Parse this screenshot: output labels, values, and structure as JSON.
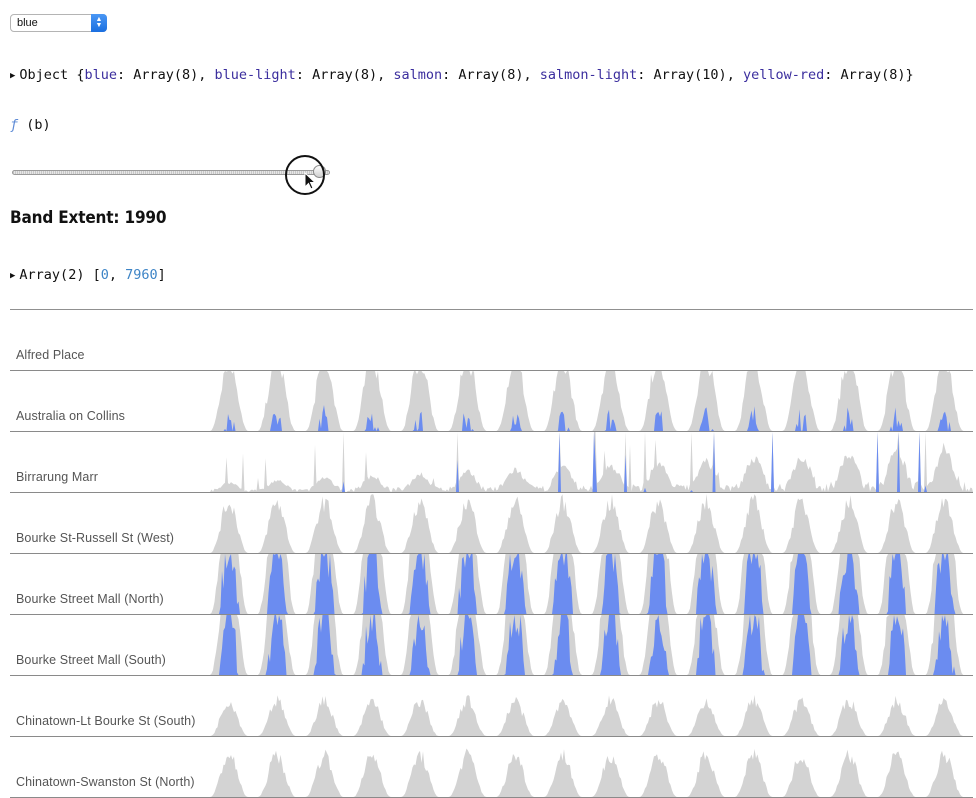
{
  "palette_select": {
    "value": "blue"
  },
  "object_line": {
    "prefix": "Object {",
    "entries": [
      {
        "key": "blue",
        "value": "Array(8)"
      },
      {
        "key": "blue-light",
        "value": "Array(8)"
      },
      {
        "key": "salmon",
        "value": "Array(8)"
      },
      {
        "key": "salmon-light",
        "value": "Array(10)"
      },
      {
        "key": "yellow-red",
        "value": "Array(8)"
      }
    ],
    "suffix": "}"
  },
  "function_line": {
    "f": "ƒ",
    "params": "(b)"
  },
  "slider": {
    "value": 1990
  },
  "band_title": "Band Extent: 1990",
  "array_line": {
    "prefix": "Array(2) [",
    "v0": "0",
    "sep": ", ",
    "v1": "7960",
    "suffix": "]"
  },
  "colors": {
    "gray_area": "#d3d3d3",
    "blue_band": "#6b8cf0",
    "text": "#111111"
  },
  "chart_data": {
    "type": "area",
    "band_extent": 1990,
    "y_extent": [
      0,
      7960
    ],
    "series": [
      {
        "name": "Alfred Place",
        "peak": 0
      },
      {
        "name": "Australia on Collins",
        "peak": 2650
      },
      {
        "name": "Birrarung Marr",
        "peak": 4000
      },
      {
        "name": "Bourke St-Russell St (West)",
        "peak": 1800
      },
      {
        "name": "Bourke Street Mall (North)",
        "peak": 4800
      },
      {
        "name": "Bourke Street Mall (South)",
        "peak": 4500
      },
      {
        "name": "Chinatown-Lt Bourke St (South)",
        "peak": 1250
      },
      {
        "name": "Chinatown-Swanston St (North)",
        "peak": 1500
      }
    ]
  }
}
